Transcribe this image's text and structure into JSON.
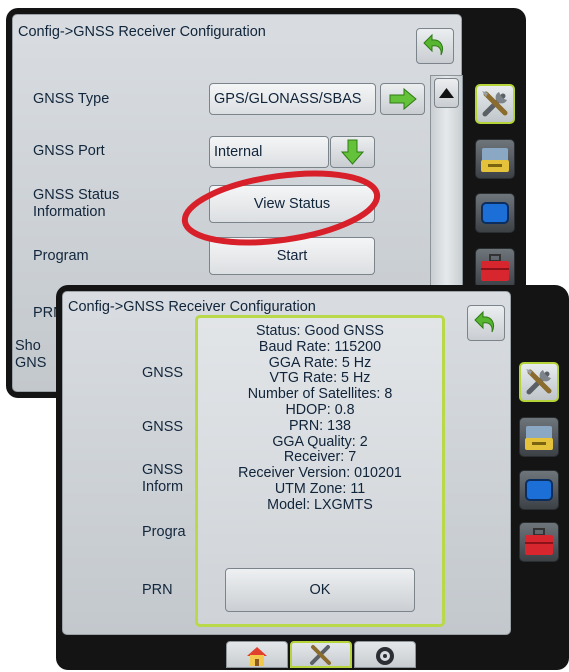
{
  "colors": {
    "accent": "#b9d84a",
    "highlight_circle": "#d8202a",
    "screen_bezel": "#141414"
  },
  "back_screen": {
    "title": "Config->GNSS Receiver Configuration",
    "rows": [
      {
        "label": "GNSS Type",
        "value": "GPS/GLONASS/SBAS",
        "action_icon": "arrow-right-icon"
      },
      {
        "label": "GNSS Port",
        "value": "Internal",
        "action_icon": "arrow-down-icon"
      },
      {
        "label": "GNSS Status Information",
        "button": "View Status"
      },
      {
        "label": "Program",
        "button": "Start"
      },
      {
        "label": "PRN"
      },
      {
        "label": "Sho GNS"
      }
    ],
    "side_tabs": [
      "tools-icon",
      "console-icon",
      "screen-icon",
      "toolbox-icon"
    ]
  },
  "front_screen": {
    "title": "Config->GNSS Receiver Configuration",
    "row_labels": [
      "GNSS",
      "GNSS",
      "GNSS Inform",
      "Progra",
      "PRN"
    ],
    "status_dialog": {
      "lines": [
        "Status: Good GNSS",
        "Baud Rate: 115200",
        "GGA Rate: 5 Hz",
        "VTG Rate: 5 Hz",
        "Number of Satellites: 8",
        "HDOP: 0.8",
        "PRN: 138",
        "GGA Quality: 2",
        "Receiver: 7",
        "Receiver Version: 010201",
        "UTM Zone: 11",
        "Model: LXGMTS"
      ],
      "ok_label": "OK"
    },
    "side_tabs": [
      "tools-icon",
      "console-icon",
      "screen-icon",
      "toolbox-icon"
    ],
    "bottom_tabs": [
      "home-icon",
      "tools-icon",
      "gauge-icon"
    ]
  }
}
